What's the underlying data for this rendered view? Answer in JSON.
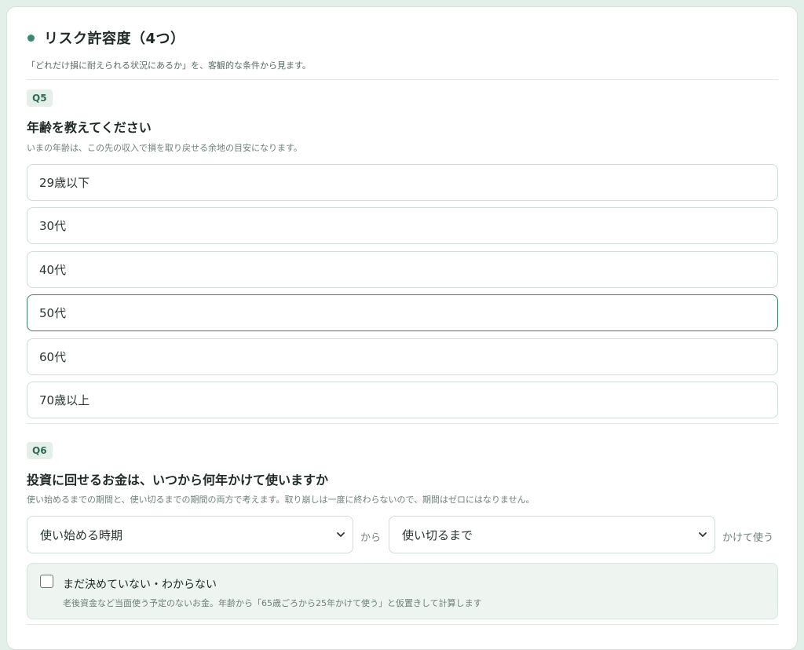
{
  "section": {
    "title": "リスク許容度（4つ）",
    "description": "「どれだけ損に耐えられる状況にあるか」を、客観的な条件から見ます。"
  },
  "q5": {
    "badge": "Q5",
    "title": "年齢を教えてください",
    "help": "いまの年齢は、この先の収入で損を取り戻せる余地の目安になります。",
    "options": [
      "29歳以下",
      "30代",
      "40代",
      "50代",
      "60代",
      "70歳以上"
    ],
    "selected": "50代"
  },
  "q6": {
    "badge": "Q6",
    "title": "投資に回せるお金は、いつから何年かけて使いますか",
    "help": "使い始めるまでの期間と、使い切るまでの期間の両方で考えます。取り崩しは一度に終わらないので、期間はゼロにはなりません。",
    "start_select": "使い始める時期",
    "from_label": "から",
    "duration_select": "使い切るまで",
    "suffix_label": "かけて使う",
    "undecided_label": "まだ決めていない・わからない",
    "undecided_help": "老後資金など当面使う予定のないお金。年齢から「65歳ごろから25年かけて使う」と仮置きして計算します",
    "undecided_checked": false
  },
  "icons": {
    "section_marker": "dot-icon",
    "select_chevron": "chevron-down-icon"
  },
  "colors": {
    "accent": "#3a8a6c",
    "page_background": "#e3efe9",
    "selected_border": "#3d7e66"
  }
}
